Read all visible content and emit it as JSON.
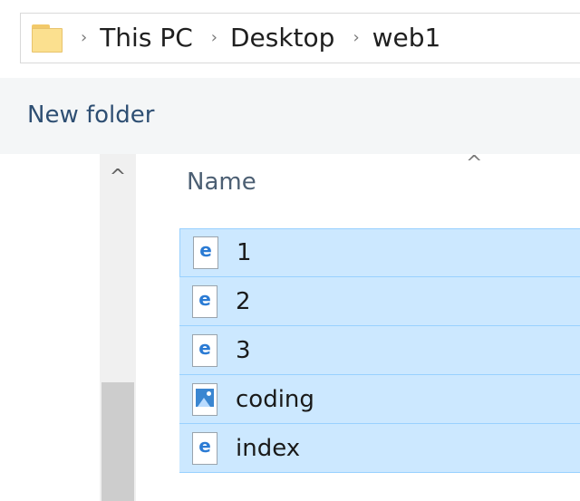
{
  "breadcrumb": {
    "items": [
      "This PC",
      "Desktop",
      "web1"
    ],
    "separator": "›"
  },
  "toolbar": {
    "new_folder_label": "New folder"
  },
  "navigation": {
    "scroll_up_glyph": "^"
  },
  "file_list": {
    "sort_indicator": "^",
    "column_header": "Name",
    "files": [
      {
        "name": "1",
        "icon": "html-file-icon"
      },
      {
        "name": "2",
        "icon": "html-file-icon"
      },
      {
        "name": "3",
        "icon": "html-file-icon"
      },
      {
        "name": "coding",
        "icon": "image-file-icon"
      },
      {
        "name": "index",
        "icon": "html-file-icon"
      }
    ],
    "selection_color": "#cce8ff",
    "selection_border": "#99d1ff"
  },
  "colors": {
    "accent_text": "#2e4f73",
    "folder": "#fbe08f",
    "edge_icon": "#2b7bd4"
  }
}
